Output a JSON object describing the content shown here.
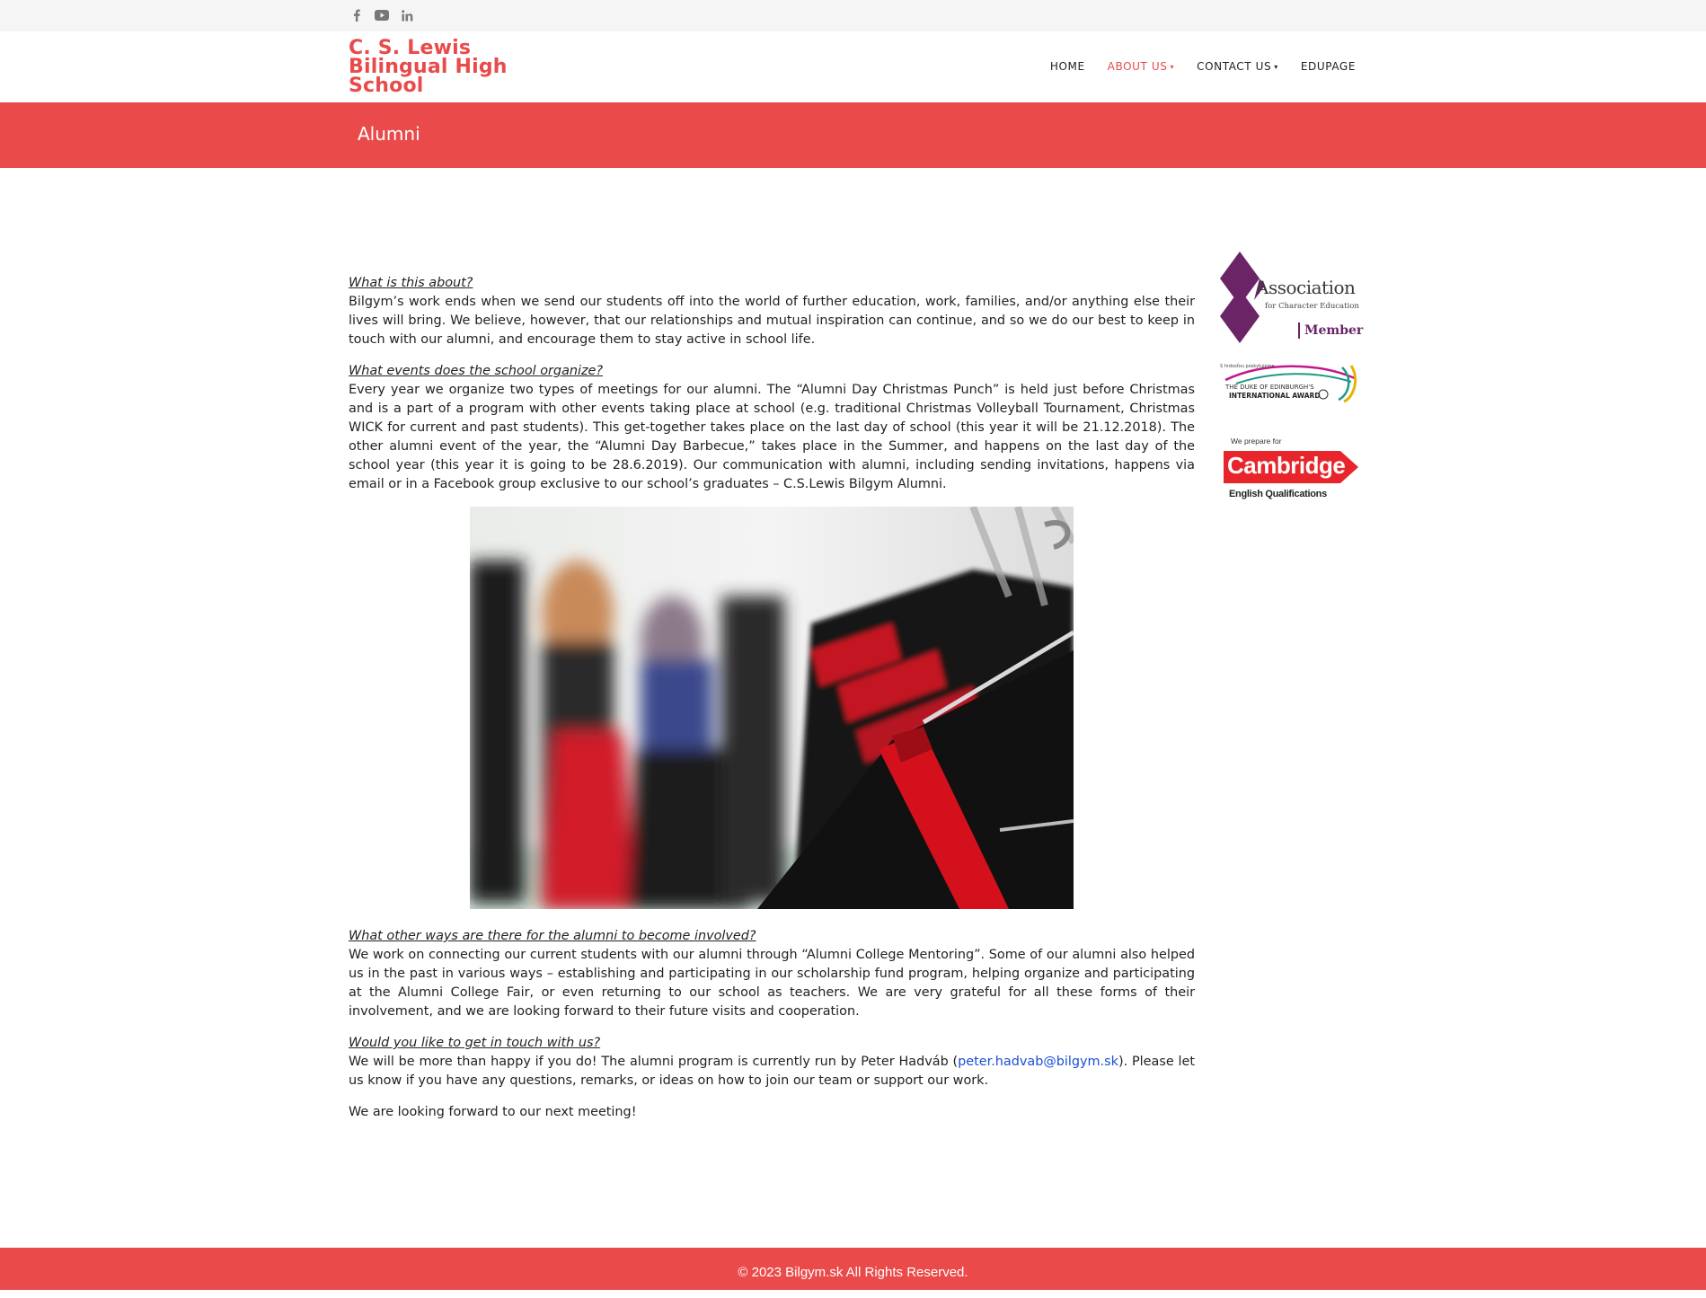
{
  "social": {
    "icons": [
      "facebook-icon",
      "youtube-icon",
      "linkedin-icon"
    ],
    "color": "#777777"
  },
  "header": {
    "logo_line1": "C. S. Lewis",
    "logo_line2": "Bilingual High",
    "logo_line3": "School",
    "brand_color": "#e94a4a"
  },
  "nav": {
    "home": "HOME",
    "about": "ABOUT US",
    "contact": "CONTACT US",
    "edupage": "EDUPAGE"
  },
  "banner": {
    "title": "Alumni",
    "color": "#eb4a4a"
  },
  "content": {
    "q1": "What is this about?",
    "p1": "Bilgym’s work ends when we send our students off into the world of further education, work, families, and/or anything else their lives will bring. We believe, however, that our relationships and mutual inspiration can continue, and so we do our best to keep in touch with our alumni, and encourage them to stay active in school life.",
    "q2": "What events does the school organize?",
    "p2": "Every year we organize two types of meetings for our alumni. The “Alumni Day Christmas Punch” is held just before Christmas and is a part of a program with other events taking place at school (e.g. traditional Christmas Volleyball Tournament, Christmas WICK for current and past students). This get-together takes place on the last day of school (this year it will be 21.12.2018). The other alumni event of the year, the “Alumni Day Barbecue,” takes place in the Summer, and happens on the last day of the school year (this year it is going to be 28.6.2019). Our communication with alumni, including sending invitations, happens via email or in a Facebook group exclusive to our school’s graduates –  C.S.Lewis Bilgym Alumni.",
    "q3": "What other ways are there for the alumni to become involved?",
    "p3": "We work on connecting our current students with our alumni through “Alumni College Mentoring”. Some of our alumni also helped us in the past in various ways – establishing and participating in our scholarship fund program, helping organize and participating at the Alumni College Fair, or even returning to our school as teachers. We are very grateful for all these forms of their involvement, and we are looking forward to their future visits and cooperation.",
    "q4": "Would you like to get in touch with us?",
    "p4_before": "We will be more than happy if you do! The alumni program is currently run by Peter Hadváb (",
    "p4_email": "peter.hadvab@bilgym.sk",
    "p4_after": "). Please let us know if you have any questions, remarks, or ideas on how to join our team or support our work.",
    "p5": "We are looking forward to our next meeting!"
  },
  "sidebar": {
    "ace_line1": "Association",
    "ace_line2": "for Character Education",
    "ace_line3": "Member",
    "doe_small": "S hrdosťou poskytujeme",
    "doe_line1": "THE DUKE OF EDINBURGH'S",
    "doe_line2": "INTERNATIONAL AWARD",
    "cam_small": "We prepare for",
    "cam_main": "Cambridge",
    "cam_sub": "English Qualifications"
  },
  "footer": {
    "text": "© 2023 Bilgym.sk All Rights Reserved."
  }
}
